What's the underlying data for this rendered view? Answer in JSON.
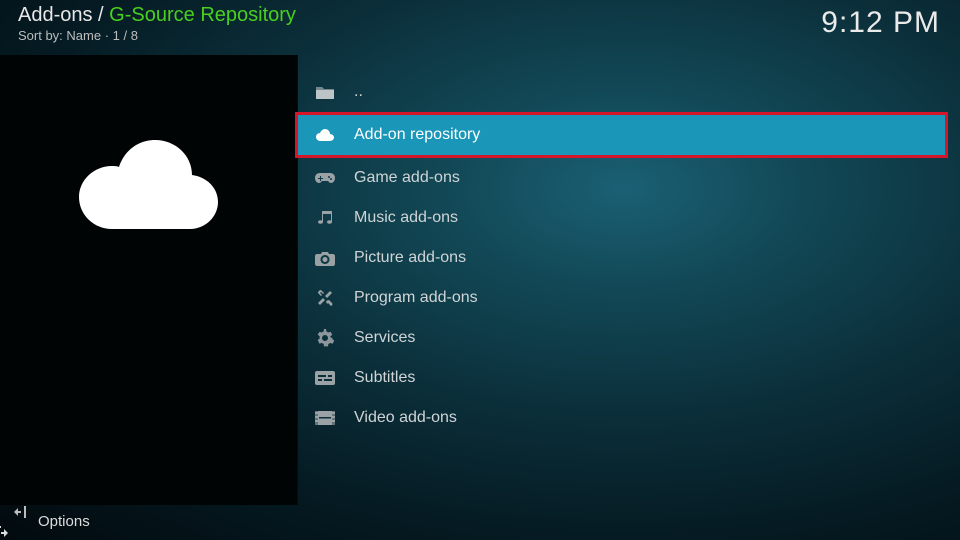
{
  "header": {
    "breadcrumb_prefix": "Add-ons",
    "breadcrumb_sep": " / ",
    "breadcrumb_current": "G-Source Repository",
    "sort_label": "Sort by: Name",
    "position": "1 / 8",
    "clock": "9:12 PM"
  },
  "list": {
    "parent": "..",
    "items": [
      {
        "label": "Add-on repository",
        "icon": "cloud-icon",
        "selected": true
      },
      {
        "label": "Game add-ons",
        "icon": "gamepad-icon",
        "selected": false
      },
      {
        "label": "Music add-ons",
        "icon": "music-icon",
        "selected": false
      },
      {
        "label": "Picture add-ons",
        "icon": "camera-icon",
        "selected": false
      },
      {
        "label": "Program add-ons",
        "icon": "tools-icon",
        "selected": false
      },
      {
        "label": "Services",
        "icon": "gear-icon",
        "selected": false
      },
      {
        "label": "Subtitles",
        "icon": "subtitles-icon",
        "selected": false
      },
      {
        "label": "Video add-ons",
        "icon": "film-icon",
        "selected": false
      }
    ]
  },
  "footer": {
    "options": "Options"
  },
  "colors": {
    "accent": "#4acf1e",
    "selected_bg": "#1a96b8",
    "highlight_border": "#d4152a"
  }
}
